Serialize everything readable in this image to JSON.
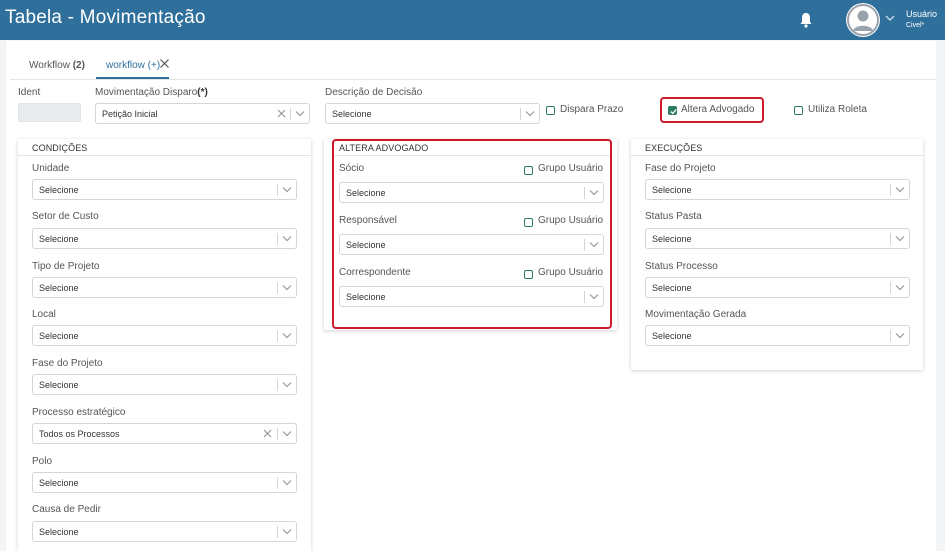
{
  "header": {
    "title": "Tabela - Movimentação",
    "user_name": "Usuário",
    "user_sub": "Civel*",
    "bell_icon": "bell-icon",
    "avatar_icon": "user-avatar-icon"
  },
  "tabs": [
    {
      "label": "Workflow ",
      "count": "(2)"
    },
    {
      "label": "workflow (+)"
    }
  ],
  "form": {
    "ident_label": "Ident",
    "movimentacao_label": "Movimentação Disparo",
    "movimentacao_req": "(*)",
    "movimentacao_value": "Petição Inicial",
    "descricao_label": "Descrição de Decisão",
    "descricao_value": "Selecione",
    "dispara_prazo": "Dispara Prazo",
    "altera_advogado": "Altera Advogado",
    "utiliza_roleta": "Utiliza Roleta"
  },
  "condicoes": {
    "title": "CONDIÇÕES",
    "fields": [
      {
        "label": "Unidade",
        "value": "Selecione"
      },
      {
        "label": "Setor de Custo",
        "value": "Selecione"
      },
      {
        "label": "Tipo de Projeto",
        "value": "Selecione"
      },
      {
        "label": "Local",
        "value": "Selecione"
      },
      {
        "label": "Fase do Projeto",
        "value": "Selecione"
      },
      {
        "label": "Processo estratégico",
        "value": "Todos os Processos"
      },
      {
        "label": "Polo",
        "value": "Selecione"
      },
      {
        "label": "Causa de Pedir",
        "value": "Selecione"
      }
    ]
  },
  "altera": {
    "title": "ALTERA ADVOGADO",
    "group_label": "Grupo Usuário",
    "fields": [
      {
        "label": "Sócio",
        "value": "Selecione"
      },
      {
        "label": "Responsável",
        "value": "Selecione"
      },
      {
        "label": "Correspondente",
        "value": "Selecione"
      }
    ]
  },
  "execucoes": {
    "title": "EXECUÇÕES",
    "fields": [
      {
        "label": "Fase do Projeto",
        "value": "Selecione"
      },
      {
        "label": "Status Pasta",
        "value": "Selecione"
      },
      {
        "label": "Status Processo",
        "value": "Selecione"
      },
      {
        "label": "Movimentação Gerada",
        "value": "Selecione"
      }
    ]
  },
  "colors": {
    "header": "#2f6f9c",
    "checkbox": "#2e7d62",
    "highlight": "#d0182b"
  }
}
